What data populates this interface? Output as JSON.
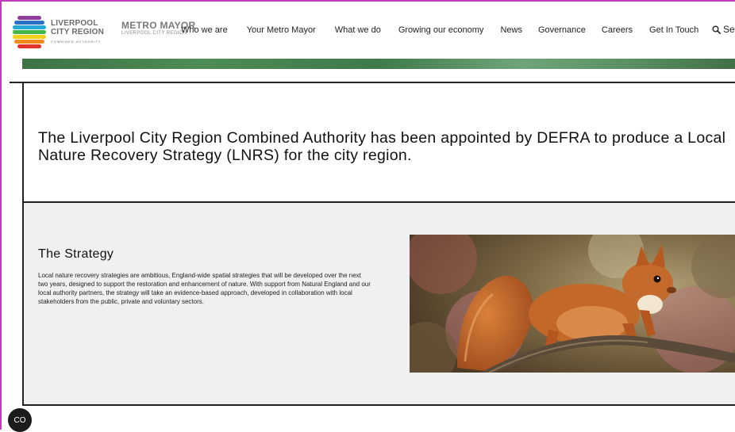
{
  "header": {
    "lcr_logo": {
      "line1": "LIVERPOOL",
      "line2": "CITY REGION",
      "line3": "COMBINED AUTHORITY"
    },
    "metro_mayor_logo": {
      "line1": "METRO MAYOR",
      "line2": "LIVERPOOL CITY REGION"
    },
    "nav": [
      "Who we are",
      "Your Metro Mayor",
      "What we do",
      "Growing our economy",
      "News",
      "Governance",
      "Careers",
      "Get In Touch"
    ],
    "search_label": "Se"
  },
  "intro": {
    "heading": "The Liverpool City Region Combined Authority has been appointed by DEFRA to produce a Local Nature Recovery Strategy (LNRS) for the city region."
  },
  "strategy": {
    "title": "The Strategy",
    "body": "Local nature recovery strategies are ambitious, England-wide spatial strategies that will be developed over the next two years, designed to support the restoration and enhancement of nature. With support from Natural England and our local authority partners, the strategy will take an evidence-based approach, developed in collaboration with local stakeholders from the public, private and voluntary sectors."
  },
  "cookie_button_label": "CO",
  "colors": {
    "frame_accent": "#c23bb7",
    "banner_green": "#4e8c55",
    "section_grey": "#f0f0f0",
    "divider": "#222222"
  }
}
